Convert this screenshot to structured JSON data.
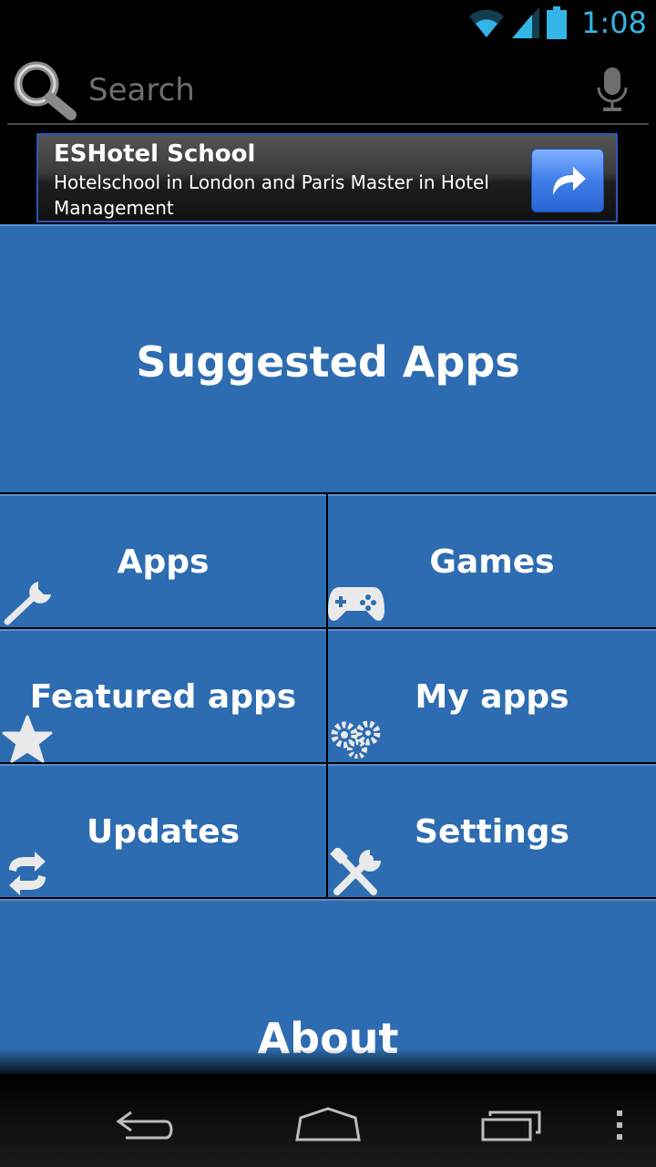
{
  "status_bar": {
    "time": "1:08",
    "icons": [
      "wifi-icon",
      "signal-icon",
      "battery-icon"
    ],
    "accent": "#33b5e5"
  },
  "search": {
    "placeholder": "Search",
    "icons": [
      "search-icon",
      "mic-icon"
    ]
  },
  "ad": {
    "title": "ESHotel School",
    "description": "Hotelschool in London and Paris Master in Hotel Management",
    "icon": "share-arrow-icon"
  },
  "tiles": {
    "suggested": "Suggested Apps",
    "apps": "Apps",
    "games": "Games",
    "featured": "Featured apps",
    "my_apps": "My apps",
    "updates": "Updates",
    "settings": "Settings",
    "about": "About"
  },
  "tile_icons": {
    "apps": "wrench-icon",
    "games": "gamepad-icon",
    "featured": "star-icon",
    "my_apps": "gears-icon",
    "updates": "refresh-icon",
    "settings": "tools-icon"
  },
  "colors": {
    "tile_blue": "#2d6cb0",
    "ad_button_blue": "#3f7ee8"
  },
  "nav_bar": {
    "icons": [
      "back-icon",
      "home-icon",
      "recents-icon",
      "menu-icon"
    ]
  }
}
